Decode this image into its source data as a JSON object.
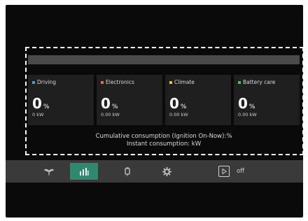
{
  "cards": [
    {
      "label": "Driving",
      "color": "#3aa0e0",
      "value": "0",
      "unit": "%",
      "power": "0 kW"
    },
    {
      "label": "Electronics",
      "color": "#e8703a",
      "value": "0",
      "unit": "%",
      "power": "0.00 kW"
    },
    {
      "label": "Climate",
      "color": "#e8c040",
      "value": "0",
      "unit": "%",
      "power": "0.00 kW"
    },
    {
      "label": "Battery care",
      "color": "#4cc060",
      "value": "0",
      "unit": "%",
      "power": "0.00 kW"
    }
  ],
  "summary": {
    "cumulative": "Cumulative consumption (Ignition On-Now):%",
    "instant": "Instant consumption: kW"
  },
  "nav": {
    "items": [
      {
        "name": "eco-leaf-icon",
        "active": false
      },
      {
        "name": "bar-chart-icon",
        "active": true
      },
      {
        "name": "battery-plug-icon",
        "active": false
      },
      {
        "name": "gear-icon",
        "active": false
      },
      {
        "name": "play-icon",
        "active": false
      }
    ],
    "play_status": "off"
  },
  "colors": {
    "accent": "#2d8a6e",
    "background": "#0a0a0a",
    "card": "#1f1f1f",
    "nav_bar": "#3a3a3a"
  }
}
